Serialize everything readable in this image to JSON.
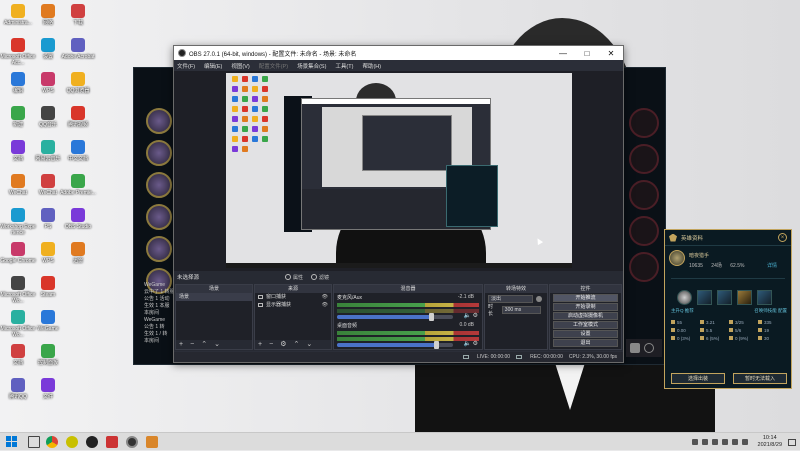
{
  "desktop": {
    "icons_col1": [
      "Administra...",
      "Microsoft Office Acc...",
      "编辑",
      "新建",
      "文档",
      "WeChat",
      "Workshop Experience",
      "Google Chrome",
      "Microsoft Office Wo...",
      "Microsoft Office Wo...",
      "文档",
      "腾讯QQ"
    ],
    "icons_col2": [
      "网络",
      "设置",
      "WPS",
      "QQ音乐",
      "网易云音乐",
      "WeChat",
      "PS",
      "WPS",
      "Steam",
      "WeGame",
      "控制面板",
      "文件"
    ],
    "icons_col3": [
      "下载",
      "Adobe Acrobat",
      "QQ浏览器",
      "腾讯视频",
      "中文文档",
      "Adobe Premie...",
      "OBS Studio",
      "迅雷"
    ]
  },
  "game_client": {
    "chat_lines": [
      "WeGame",
      "云中了 1 转服务器",
      "公告 1 活动",
      "生效 1 本服",
      "本房间",
      "WeGame",
      "公告 1 转",
      "生效 1 / 转",
      "本房间"
    ]
  },
  "obs": {
    "title": "OBS 27.0.1 (64-bit, windows) - 配置文件: 未命名 - 场景: 未命名",
    "menu": [
      "文件(F)",
      "编辑(E)",
      "视图(V)",
      "配置文件(P)",
      "场景集合(S)",
      "工具(T)",
      "帮助(H)"
    ],
    "scene_bar": {
      "label": "未选择源",
      "properties": "属性",
      "filters": "滤镜"
    },
    "docks": {
      "scenes": {
        "title": "场景",
        "items": [
          "场景"
        ]
      },
      "sources": {
        "title": "来源",
        "items": [
          "窗口捕获",
          "显示器捕获"
        ]
      },
      "mixer": {
        "title": "混音器",
        "tracks": [
          {
            "name": "麦克风/Aux",
            "db": "-2.1 dB",
            "level": 0.82
          },
          {
            "name": "桌面音频",
            "db": "0.0 dB",
            "level": 0.86
          }
        ]
      },
      "transitions": {
        "title": "转场特效",
        "type": "淡出",
        "duration_label": "时长",
        "duration": "300 ms"
      },
      "controls": {
        "title": "控件",
        "buttons": [
          "开始推流",
          "开始录制",
          "启动虚拟摄像机",
          "工作室模式",
          "设置",
          "退出"
        ]
      }
    },
    "statusbar": {
      "live": "LIVE: 00:00:00",
      "rec": "REC: 00:00:00",
      "cpu": "CPU: 2.3%, 30.00 fps"
    }
  },
  "stats_panel": {
    "title": "英雄资料",
    "champion": "暗夜猎手",
    "games": "10635",
    "rank": "24场",
    "winrate": "62.5%",
    "link": "详情",
    "sub_left": "主升Q 推荐",
    "sub_right": "召唤师技能 配置",
    "stat_rows": [
      [
        "55",
        "3.21",
        "3/25",
        "335"
      ],
      [
        "0.00",
        "5.5",
        "5/6",
        "19"
      ],
      [
        "0 (3%)",
        "6 (5%)",
        "0 (9%)",
        "30"
      ]
    ],
    "btn_left": "选择出装",
    "btn_right": "暂时无法载入",
    "colors": {
      "border": "#c2a45d",
      "bg": "#0a1a22"
    }
  },
  "taskbar": {
    "time": "10:14",
    "date": "2021/8/29"
  }
}
